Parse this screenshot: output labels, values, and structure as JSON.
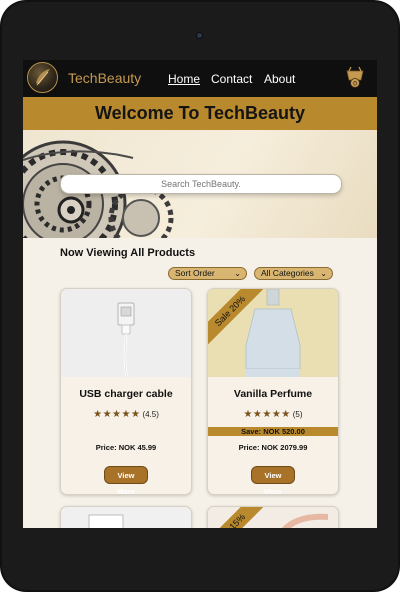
{
  "brand": {
    "name": "TechBeauty"
  },
  "nav": {
    "items": [
      {
        "label": "Home"
      },
      {
        "label": "Contact"
      },
      {
        "label": "About"
      }
    ],
    "cart_count": "0"
  },
  "banner": {
    "title": "Welcome To TechBeauty"
  },
  "search": {
    "placeholder": "Search TechBeauty."
  },
  "section": {
    "title": "Now Viewing All Products"
  },
  "filters": {
    "sort_label": "Sort Order",
    "category_label": "All Categories"
  },
  "products": [
    {
      "title": "USB charger cable",
      "stars": "★★★★★",
      "rating": "(4.5)",
      "save": "",
      "price": "Price: NOK 45.99",
      "button": "View More",
      "ribbon": ""
    },
    {
      "title": "Vanilla Perfume",
      "stars": "★★★★★",
      "rating": "(5)",
      "save": "Save: NOK 520.00",
      "price": "Price: NOK 2079.99",
      "button": "View More",
      "ribbon": "Sale 20%"
    },
    {
      "title": "",
      "ribbon": ""
    },
    {
      "title": "",
      "ribbon": "Sale 15%"
    }
  ],
  "colors": {
    "gold": "#b8892d",
    "nav_bg": "#0f0f0f",
    "page_bg": "#f6f1e8"
  }
}
